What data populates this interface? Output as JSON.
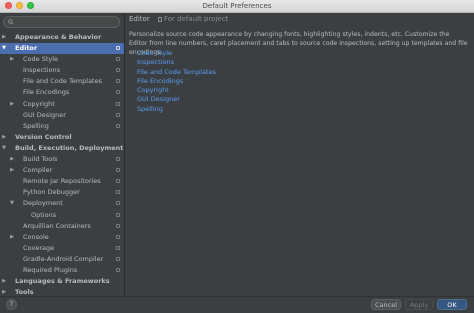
{
  "window": {
    "title": "Default Preferences"
  },
  "search": {
    "placeholder": ""
  },
  "sidebar": {
    "items": [
      {
        "label": "Appearance & Behavior",
        "level": 0,
        "expandable": true,
        "expanded": false,
        "bold": true,
        "selected": false,
        "copy_icon": false
      },
      {
        "label": "Editor",
        "level": 0,
        "expandable": true,
        "expanded": true,
        "bold": true,
        "selected": true,
        "copy_icon": true
      },
      {
        "label": "Code Style",
        "level": 1,
        "expandable": true,
        "expanded": false,
        "bold": false,
        "selected": false,
        "copy_icon": true
      },
      {
        "label": "Inspections",
        "level": 1,
        "expandable": false,
        "bold": false,
        "selected": false,
        "copy_icon": true
      },
      {
        "label": "File and Code Templates",
        "level": 1,
        "expandable": false,
        "bold": false,
        "selected": false,
        "copy_icon": true
      },
      {
        "label": "File Encodings",
        "level": 1,
        "expandable": false,
        "bold": false,
        "selected": false,
        "copy_icon": true
      },
      {
        "label": "Copyright",
        "level": 1,
        "expandable": true,
        "expanded": false,
        "bold": false,
        "selected": false,
        "copy_icon": true
      },
      {
        "label": "GUI Designer",
        "level": 1,
        "expandable": false,
        "bold": false,
        "selected": false,
        "copy_icon": true
      },
      {
        "label": "Spelling",
        "level": 1,
        "expandable": false,
        "bold": false,
        "selected": false,
        "copy_icon": true
      },
      {
        "label": "Version Control",
        "level": 0,
        "expandable": true,
        "expanded": false,
        "bold": true,
        "selected": false,
        "copy_icon": false
      },
      {
        "label": "Build, Execution, Deployment",
        "level": 0,
        "expandable": true,
        "expanded": true,
        "bold": true,
        "selected": false,
        "copy_icon": false
      },
      {
        "label": "Build Tools",
        "level": 1,
        "expandable": true,
        "expanded": false,
        "bold": false,
        "selected": false,
        "copy_icon": true
      },
      {
        "label": "Compiler",
        "level": 1,
        "expandable": true,
        "expanded": false,
        "bold": false,
        "selected": false,
        "copy_icon": true
      },
      {
        "label": "Remote Jar Repositories",
        "level": 1,
        "expandable": false,
        "bold": false,
        "selected": false,
        "copy_icon": true
      },
      {
        "label": "Python Debugger",
        "level": 1,
        "expandable": false,
        "bold": false,
        "selected": false,
        "copy_icon": true
      },
      {
        "label": "Deployment",
        "level": 1,
        "expandable": true,
        "expanded": true,
        "bold": false,
        "selected": false,
        "copy_icon": true
      },
      {
        "label": "Options",
        "level": 2,
        "expandable": false,
        "bold": false,
        "selected": false,
        "copy_icon": true
      },
      {
        "label": "Arquillian Containers",
        "level": 1,
        "expandable": false,
        "bold": false,
        "selected": false,
        "copy_icon": true
      },
      {
        "label": "Console",
        "level": 1,
        "expandable": true,
        "expanded": false,
        "bold": false,
        "selected": false,
        "copy_icon": true
      },
      {
        "label": "Coverage",
        "level": 1,
        "expandable": false,
        "bold": false,
        "selected": false,
        "copy_icon": true
      },
      {
        "label": "Gradle-Android Compiler",
        "level": 1,
        "expandable": false,
        "bold": false,
        "selected": false,
        "copy_icon": true
      },
      {
        "label": "Required Plugins",
        "level": 1,
        "expandable": false,
        "bold": false,
        "selected": false,
        "copy_icon": true
      },
      {
        "label": "Languages & Frameworks",
        "level": 0,
        "expandable": true,
        "expanded": false,
        "bold": true,
        "selected": false,
        "copy_icon": false
      },
      {
        "label": "Tools",
        "level": 0,
        "expandable": true,
        "expanded": false,
        "bold": true,
        "selected": false,
        "copy_icon": false
      }
    ]
  },
  "main": {
    "breadcrumb": "Editor",
    "breadcrumb_sub": "For default project",
    "description": "Personalize source code appearance by changing fonts, highlighting styles, indents, etc. Customize the Editor from line numbers, caret placement and tabs to source code inspections, setting up templates and file encodings.",
    "links": [
      "Code Style",
      "Inspections",
      "File and Code Templates",
      "File Encodings",
      "Copyright",
      "GUI Designer",
      "Spelling"
    ]
  },
  "footer": {
    "help_label": "?",
    "cancel_label": "Cancel",
    "apply_label": "Apply",
    "ok_label": "OK"
  },
  "colors": {
    "background": "#3c3f41",
    "selection": "#4b6eaf",
    "link": "#589df6",
    "primary_button": "#365880"
  }
}
